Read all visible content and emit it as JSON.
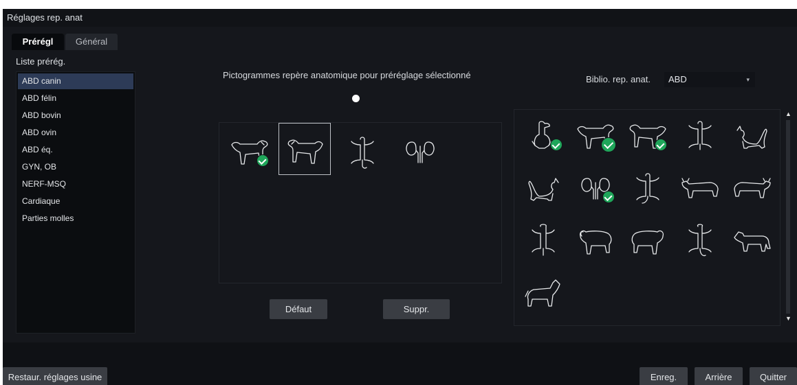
{
  "window": {
    "title": "Réglages rep. anat"
  },
  "tabs": [
    {
      "label": "Prérégl",
      "active": true
    },
    {
      "label": "Général",
      "active": false
    }
  ],
  "preset_list": {
    "label": "Liste prérég.",
    "items": [
      {
        "label": "ABD canin",
        "selected": true
      },
      {
        "label": "ABD félin"
      },
      {
        "label": "ABD bovin"
      },
      {
        "label": "ABD ovin"
      },
      {
        "label": "ABD éq."
      },
      {
        "label": "GYN, OB"
      },
      {
        "label": "NERF-MSQ"
      },
      {
        "label": "Cardiaque"
      },
      {
        "label": "Parties molles"
      }
    ]
  },
  "selected_pictos": {
    "title": "Pictogrammes repère anatomique pour préréglage sélectionné",
    "items": [
      {
        "icon": "dog-lateral-right-icon",
        "checked": true
      },
      {
        "icon": "dog-lateral-left-icon",
        "selected": true
      },
      {
        "icon": "dog-dorsal-icon"
      },
      {
        "icon": "kidneys-icon"
      }
    ]
  },
  "buttons": {
    "default": "Défaut",
    "delete": "Suppr."
  },
  "library": {
    "label": "Biblio. rep. anat.",
    "selected": "ABD",
    "items": [
      {
        "icon": "dog-sitting-dorsal-icon",
        "checked": true
      },
      {
        "icon": "dog-lateral-right-icon",
        "checked": true,
        "big": true
      },
      {
        "icon": "dog-lateral-left-icon",
        "checked": true
      },
      {
        "icon": "dog-dorsal-icon"
      },
      {
        "icon": "cat-lateral-right-icon"
      },
      {
        "icon": "cat-lateral-left-icon"
      },
      {
        "icon": "kidneys-icon",
        "checked": true
      },
      {
        "icon": "cat-dorsal-icon"
      },
      {
        "icon": "cow-lateral-right-icon"
      },
      {
        "icon": "cow-lateral-left-icon"
      },
      {
        "icon": "cow-dorsal-icon"
      },
      {
        "icon": "sheep-lateral-right-icon"
      },
      {
        "icon": "sheep-lateral-left-icon"
      },
      {
        "icon": "sheep-dorsal-icon"
      },
      {
        "icon": "horse-lateral-right-icon"
      },
      {
        "icon": "horse-lateral-left-icon"
      }
    ]
  },
  "footer": {
    "restore": "Restaur. réglages usine",
    "save": "Enreg.",
    "back": "Arrière",
    "quit": "Quitter"
  }
}
